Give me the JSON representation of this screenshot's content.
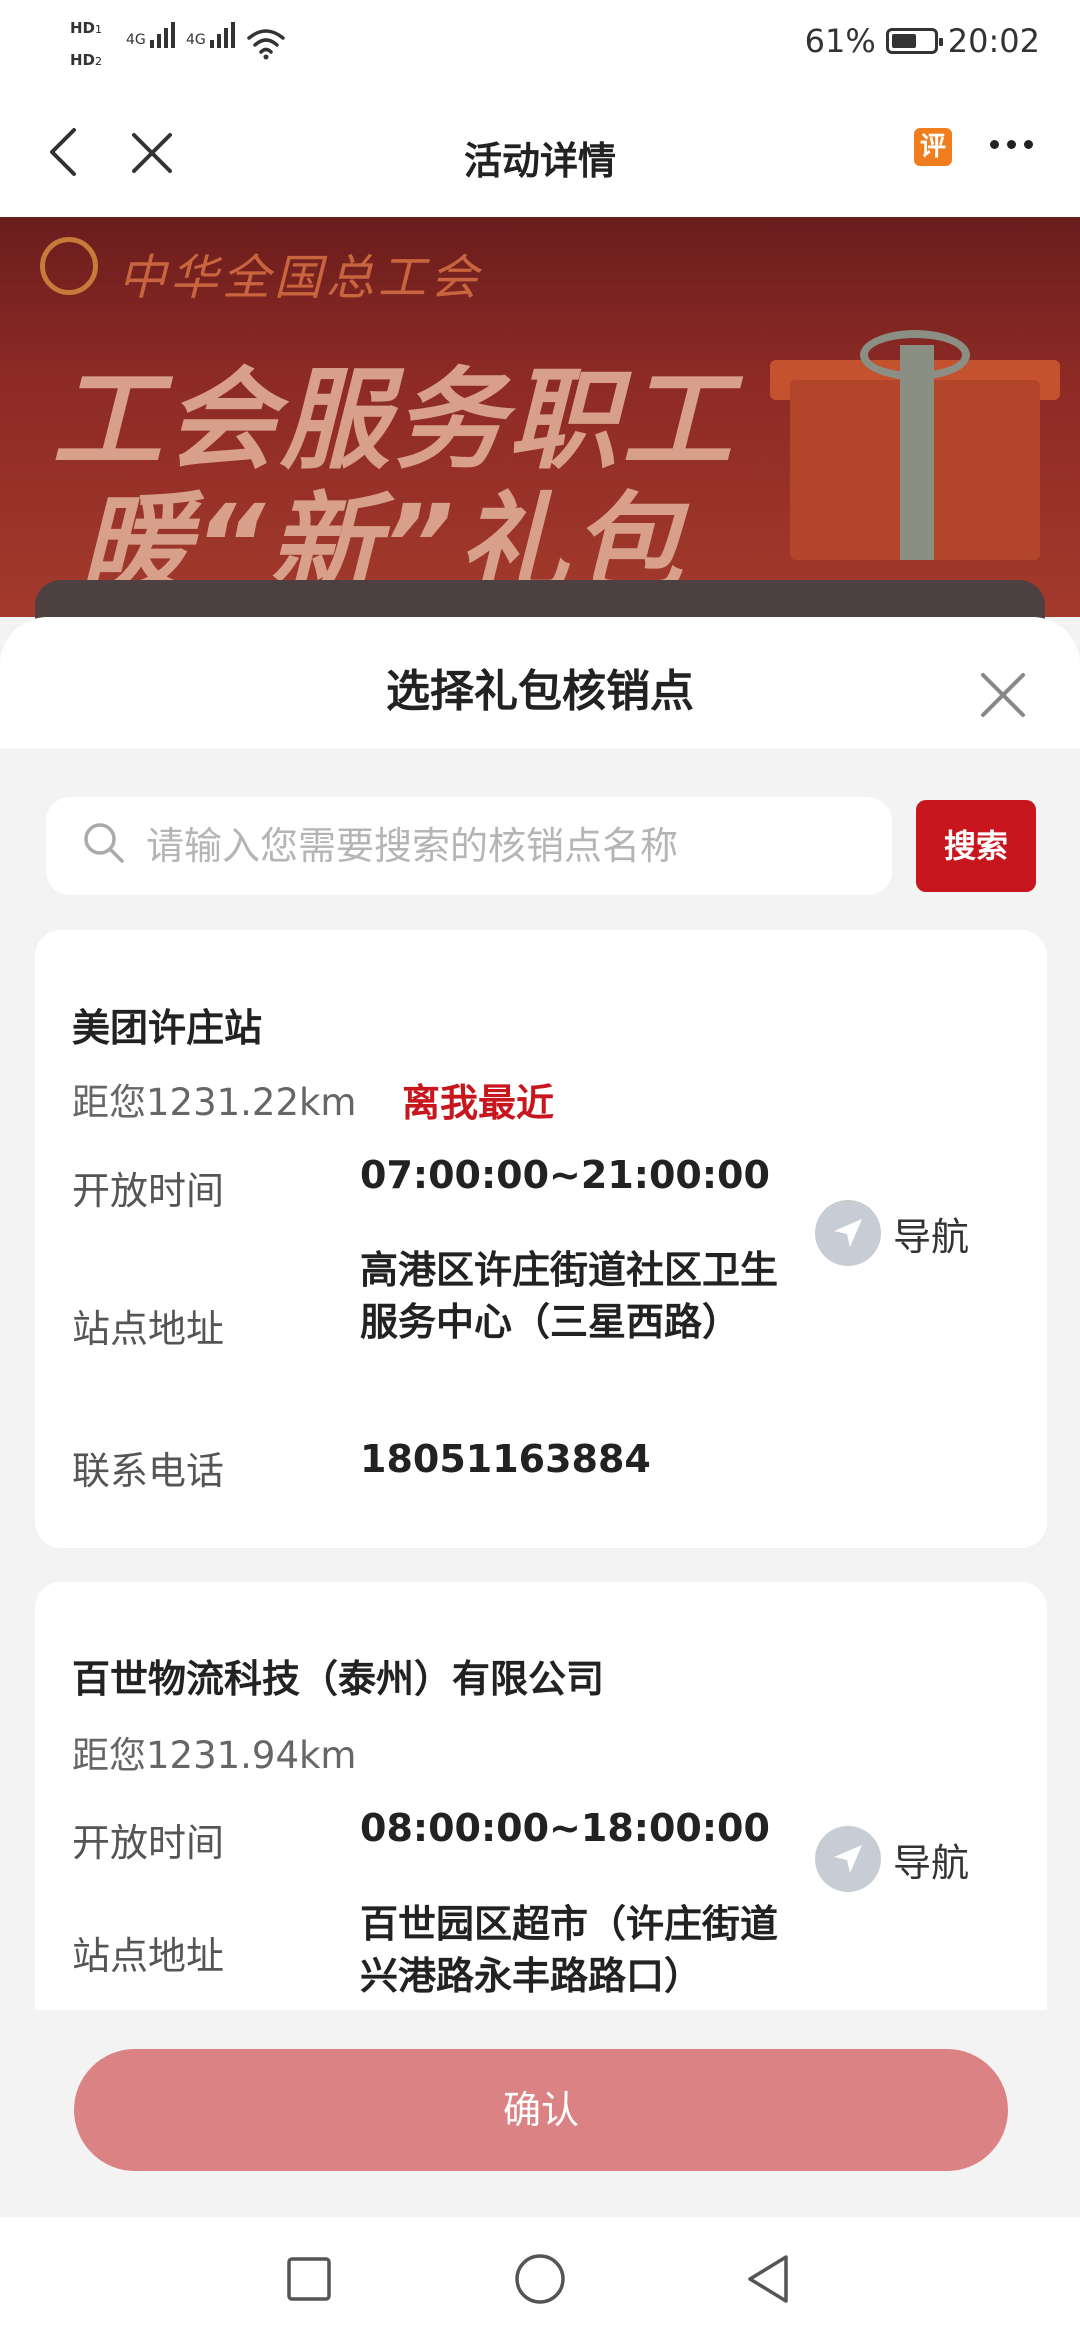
{
  "status_bar": {
    "hd1": "HD",
    "hd1_sub": "1",
    "hd2": "HD",
    "hd2_sub": "2",
    "network1": "4G",
    "network2": "4G",
    "battery_percent": "61%",
    "battery_level": 0.61,
    "time": "20:02"
  },
  "nav": {
    "title": "活动详情",
    "review_badge": "评"
  },
  "banner": {
    "org": "中华全国总工会",
    "line1": "工会服务职工",
    "line2": "暖“新”礼包"
  },
  "sheet": {
    "title": "选择礼包核销点"
  },
  "search": {
    "placeholder": "请输入您需要搜索的核销点名称",
    "button_label": "搜索"
  },
  "labels": {
    "open_time": "开放时间",
    "address": "站点地址",
    "phone": "联系电话",
    "navigate": "导航"
  },
  "stations": [
    {
      "name": "美团许庄站",
      "distance": "距您1231.22km",
      "tag": "离我最近",
      "open_time": "07:00:00~21:00:00",
      "address": "高港区许庄街道社区卫生服务中心（三星西路）",
      "phone": "18051163884"
    },
    {
      "name": "百世物流科技（泰州）有限公司",
      "distance": "距您1231.94km",
      "open_time": "08:00:00~18:00:00",
      "address": "百世园区超市（许庄街道兴港路永丰路路口）"
    }
  ],
  "confirm": {
    "label": "确认"
  },
  "colors": {
    "accent": "#c8161e",
    "confirm_bg": "#db8285",
    "review_badge": "#f07e1e"
  },
  "icons": [
    "back-icon",
    "close-icon",
    "review-badge-icon",
    "more-icon",
    "search-icon",
    "navigation-arrow-icon",
    "recent-apps-icon",
    "home-icon",
    "back-triangle-icon"
  ]
}
